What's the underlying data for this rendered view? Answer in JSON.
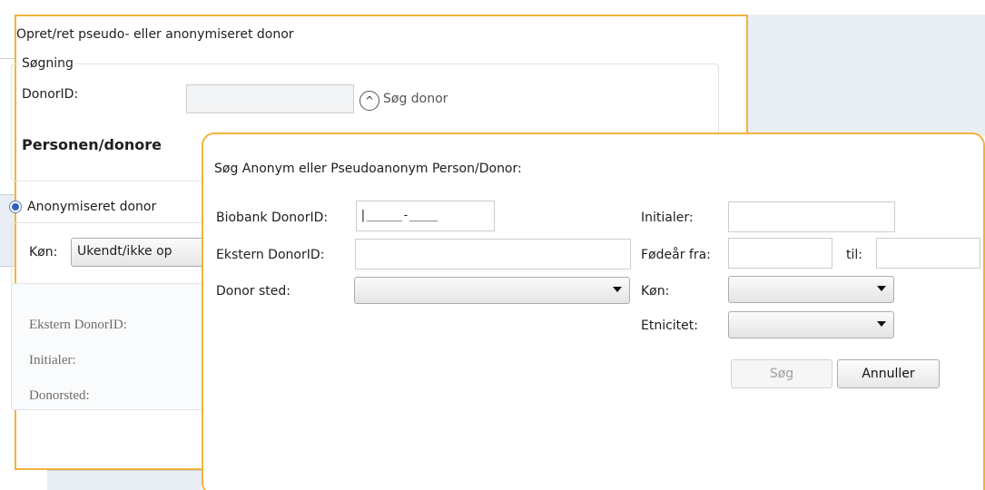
{
  "back_window": {
    "title": "Opret/ret pseudo- eller anonymiseret donor",
    "search_group": {
      "legend": "Søgning",
      "donorid_label": "DonorID:",
      "search_link": "Søg donor"
    },
    "person_heading": "Personen/donore",
    "radio_label": "Anonymiseret donor",
    "gender_label": "Køn:",
    "gender_value": "Ukendt/ikke op",
    "info_labels": {
      "ekstern": "Ekstern DonorID:",
      "initialer": "Initialer:",
      "donorsted": "Donorsted:"
    }
  },
  "dialog": {
    "title": "Søg Anonym eller Pseudoanonym Person/Donor:",
    "biobank_label": "Biobank DonorID:",
    "biobank_mask": "|_____-____",
    "ekstern_label": "Ekstern DonorID:",
    "donor_sted_label": "Donor sted:",
    "initialer_label": "Initialer:",
    "fodear_label": "Fødeår fra:",
    "til_label": "til:",
    "kon_label": "Køn:",
    "etnicitet_label": "Etnicitet:",
    "search_button": "Søg",
    "cancel_button": "Annuller"
  },
  "colors": {
    "accent_border": "#f0b43c",
    "radio_selected": "#2f62c0"
  }
}
